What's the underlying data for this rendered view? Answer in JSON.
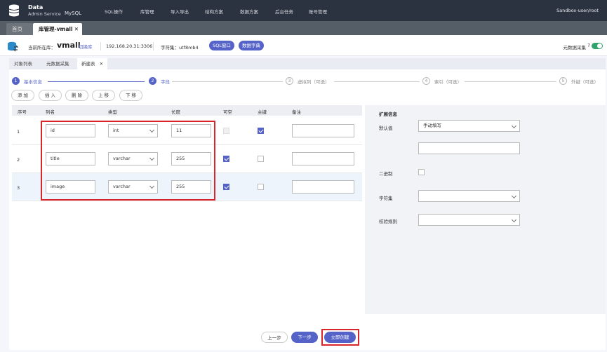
{
  "app": {
    "brand_line1": "Data",
    "brand_line2": "Admin Service",
    "brand_line3": "MySQL",
    "user": "Sandbox-user/root"
  },
  "nav": [
    "SQL操作",
    "库管理",
    "导入导出",
    "结构方案",
    "数据方案",
    "后台任务",
    "账号管理"
  ],
  "page_tabs": [
    {
      "label": "首页"
    },
    {
      "label": "库管理-vmall",
      "close": "✕"
    }
  ],
  "db_bar": {
    "current_label": "当前所在库：",
    "db_name": "vmall",
    "switch_label": "切换库",
    "ip": "192.168.20.31:3306",
    "charset": "字符集：utf8mb4",
    "btn_sql": "SQL窗口",
    "btn_dict": "数据字典",
    "meta_collect": "元数据采集",
    "help": "?"
  },
  "sub_tabs": [
    {
      "label": "对象列表"
    },
    {
      "label": "元数据采集"
    },
    {
      "label": "新建表",
      "close": "✕"
    }
  ],
  "steps": [
    {
      "num": "1",
      "label": "基本信息"
    },
    {
      "num": "2",
      "label": "字段"
    },
    {
      "num": "3",
      "label": "虚拟列（可选）"
    },
    {
      "num": "4",
      "label": "索引（可选）"
    },
    {
      "num": "5",
      "label": "外键（可选）"
    }
  ],
  "toolbar": {
    "add": "添 加",
    "insert": "插 入",
    "delete": "删 除",
    "up": "上 移",
    "down": "下 移"
  },
  "table": {
    "headers": {
      "num": "序号",
      "col": "列名",
      "type": "类型",
      "len": "长度",
      "nullable": "可空",
      "pk": "主键",
      "comment": "备注"
    },
    "rows": [
      {
        "num": "1",
        "name": "id",
        "type": "int",
        "length": "11",
        "nullable": false,
        "pk": true,
        "comment": ""
      },
      {
        "num": "2",
        "name": "title",
        "type": "varchar",
        "length": "255",
        "nullable": true,
        "pk": false,
        "comment": ""
      },
      {
        "num": "3",
        "name": "image",
        "type": "varchar",
        "length": "255",
        "nullable": true,
        "pk": false,
        "comment": ""
      }
    ]
  },
  "ext": {
    "title": "扩展信息",
    "default_label": "默认值",
    "default_value": "手动填写",
    "binary_label": "二进制",
    "charset_label": "字符集",
    "collation_label": "校验规则"
  },
  "footer": {
    "prev": "上一步",
    "next": "下一步",
    "create": "立即创建"
  },
  "colors": {
    "accent": "#5563c8",
    "topbar": "#2c3340",
    "highlight": "#d9262a"
  }
}
